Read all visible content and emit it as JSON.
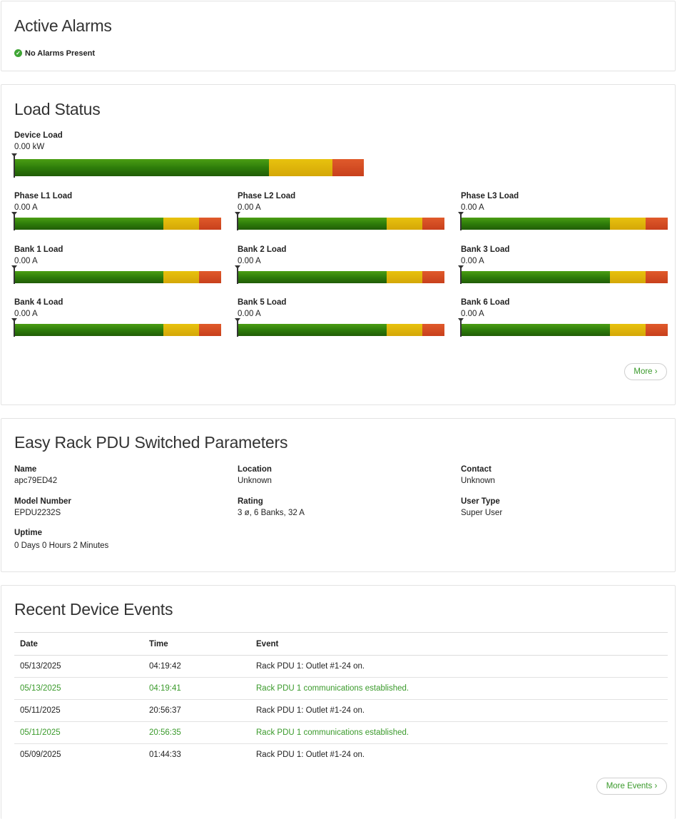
{
  "alarms": {
    "title": "Active Alarms",
    "status_text": "No Alarms Present",
    "status_icon": "check-circle-icon",
    "status_color": "#3fa535"
  },
  "load": {
    "title": "Load Status",
    "device": {
      "label": "Device Load",
      "value": "0.00 kW",
      "level": 0
    },
    "items": [
      {
        "label": "Phase L1 Load",
        "value": "0.00 A",
        "level": 0
      },
      {
        "label": "Phase L2 Load",
        "value": "0.00 A",
        "level": 0
      },
      {
        "label": "Phase L3 Load",
        "value": "0.00 A",
        "level": 0
      },
      {
        "label": "Bank 1 Load",
        "value": "0.00 A",
        "level": 0
      },
      {
        "label": "Bank 2 Load",
        "value": "0.00 A",
        "level": 0
      },
      {
        "label": "Bank 3 Load",
        "value": "0.00 A",
        "level": 0
      },
      {
        "label": "Bank 4 Load",
        "value": "0.00 A",
        "level": 0
      },
      {
        "label": "Bank 5 Load",
        "value": "0.00 A",
        "level": 0
      },
      {
        "label": "Bank 6 Load",
        "value": "0.00 A",
        "level": 0
      }
    ],
    "more_label": "More ›",
    "colors": {
      "normal": "#2e7d0a",
      "warning": "#e0b70b",
      "critical": "#d54b22"
    }
  },
  "params": {
    "title": "Easy Rack PDU Switched Parameters",
    "name_label": "Name",
    "name_value": "apc79ED42",
    "location_label": "Location",
    "location_value": "Unknown",
    "contact_label": "Contact",
    "contact_value": "Unknown",
    "model_label": "Model Number",
    "model_value": "EPDU2232S",
    "rating_label": "Rating",
    "rating_value": "3 ø, 6 Banks, 32 A",
    "usertype_label": "User Type",
    "usertype_value": "Super User",
    "uptime_label": "Uptime",
    "uptime_value": "0 Days 0 Hours 2 Minutes"
  },
  "events": {
    "title": "Recent Device Events",
    "columns": {
      "date": "Date",
      "time": "Time",
      "event": "Event"
    },
    "rows": [
      {
        "date": "05/13/2025",
        "time": "04:19:42",
        "event": "Rack PDU 1: Outlet #1-24 on.",
        "highlight": false
      },
      {
        "date": "05/13/2025",
        "time": "04:19:41",
        "event": "Rack PDU 1 communications established.",
        "highlight": true
      },
      {
        "date": "05/11/2025",
        "time": "20:56:37",
        "event": "Rack PDU 1: Outlet #1-24 on.",
        "highlight": false
      },
      {
        "date": "05/11/2025",
        "time": "20:56:35",
        "event": "Rack PDU 1 communications established.",
        "highlight": true
      },
      {
        "date": "05/09/2025",
        "time": "01:44:33",
        "event": "Rack PDU 1: Outlet #1-24 on.",
        "highlight": false
      }
    ],
    "more_label": "More Events ›",
    "highlight_color": "#3a9a2b"
  }
}
